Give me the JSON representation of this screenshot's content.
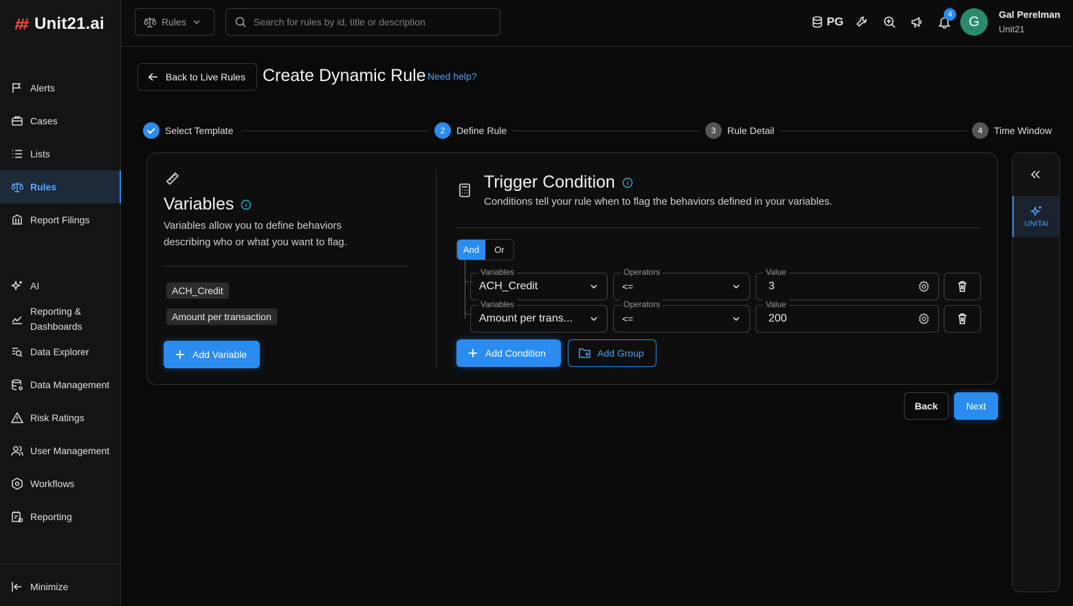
{
  "brand": {
    "logo_text": "Unit21.ai",
    "accent": "#2b8cf0"
  },
  "sidebar": {
    "items": [
      {
        "label": "Alerts",
        "icon": "flag-icon"
      },
      {
        "label": "Cases",
        "icon": "briefcase-icon"
      },
      {
        "label": "Lists",
        "icon": "list-icon"
      },
      {
        "label": "Rules",
        "icon": "scale-icon"
      },
      {
        "label": "Report Filings",
        "icon": "bank-icon"
      },
      {
        "label": "AI",
        "icon": "sparkle-icon"
      },
      {
        "label": "Reporting &",
        "label2": "Dashboards",
        "icon": "chart-line-icon"
      },
      {
        "label": "Data Explorer",
        "icon": "data-search-icon"
      },
      {
        "label": "Data Management",
        "icon": "database-icon"
      },
      {
        "label": "Risk Ratings",
        "icon": "warning-icon"
      },
      {
        "label": "User Management",
        "icon": "users-icon"
      },
      {
        "label": "Workflows",
        "icon": "gear-flow-icon"
      },
      {
        "label": "Reporting",
        "icon": "report-icon"
      }
    ],
    "active": "Rules",
    "minimize_label": "Minimize"
  },
  "topbar": {
    "scope_label": "Rules",
    "search_placeholder": "Search for rules by id, title or description",
    "db_label": "PG",
    "notification_count": "4",
    "user": {
      "initial": "G",
      "name": "Gal Perelman",
      "org": "Unit21"
    }
  },
  "header": {
    "back_label": "Back to Live Rules",
    "title": "Create Dynamic Rule",
    "help_label": "Need help?"
  },
  "stepper": {
    "steps": [
      {
        "num": "",
        "label": "Select Template",
        "state": "done"
      },
      {
        "num": "2",
        "label": "Define Rule",
        "state": "current"
      },
      {
        "num": "3",
        "label": "Rule Detail",
        "state": "pending"
      },
      {
        "num": "4",
        "label": "Time Window",
        "state": "pending"
      }
    ]
  },
  "variables": {
    "title": "Variables",
    "description": "Variables allow you to define behaviors describing who or what you want to flag.",
    "chips": [
      "ACH_Credit",
      "Amount per transaction"
    ],
    "add_label": "Add Variable"
  },
  "trigger": {
    "title": "Trigger Condition",
    "description": "Conditions tell your rule when to flag the behaviors defined in your variables.",
    "logic": {
      "and": "And",
      "or": "Or",
      "selected": "And"
    },
    "conditions": [
      {
        "variable_label": "Variables",
        "variable": "ACH_Credit",
        "operator_label": "Operators",
        "operator": "<=",
        "value_label": "Value",
        "value": "3"
      },
      {
        "variable_label": "Variables",
        "variable": "Amount per trans...",
        "operator_label": "Operators",
        "operator": "<=",
        "value_label": "Value",
        "value": "200"
      }
    ],
    "add_condition_label": "Add Condition",
    "add_group_label": "Add Group"
  },
  "footer": {
    "back_label": "Back",
    "next_label": "Next"
  },
  "right_panel": {
    "assistant_label": "UNITAI"
  }
}
